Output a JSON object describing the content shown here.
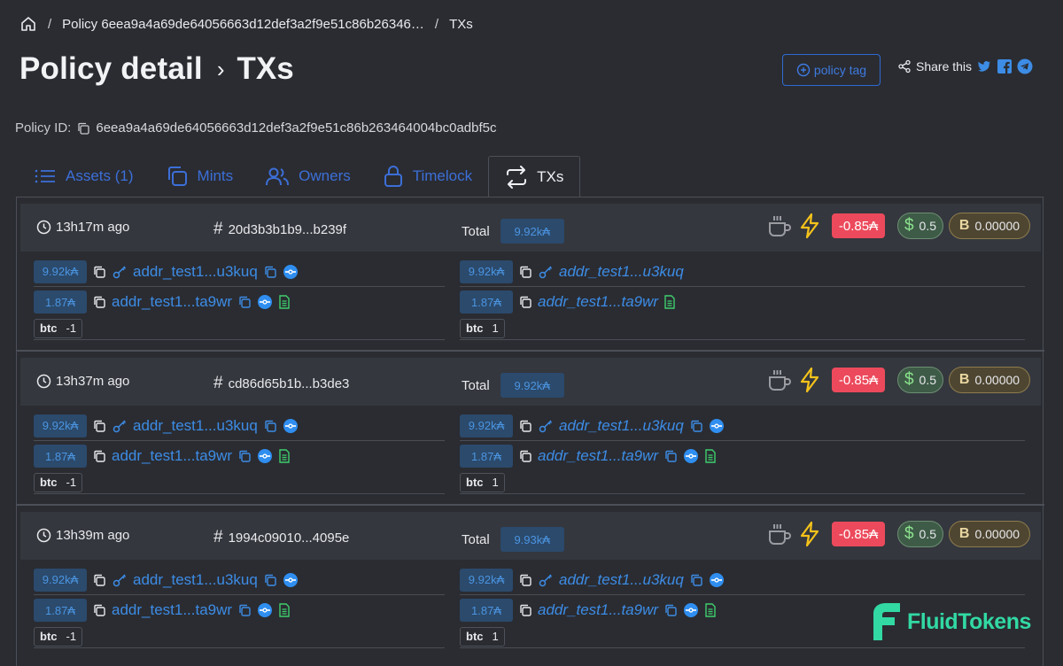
{
  "breadcrumb": {
    "home_icon": "home-icon",
    "policy_crumb": "Policy 6eea9a4a69de64056663d12def3a2f9e51c86b26346…",
    "current": "TXs"
  },
  "header": {
    "title": "Policy detail",
    "subtitle": "TXs",
    "policy_tag_label": "policy tag",
    "share_label": "Share this"
  },
  "policy": {
    "label": "Policy ID:",
    "id": "6eea9a4a69de64056663d12def3a2f9e51c86b263464004bc0adbf5c"
  },
  "tabs": [
    {
      "label": "Assets (1)",
      "icon": "list-icon",
      "active": false
    },
    {
      "label": "Mints",
      "icon": "copy-icon",
      "active": false
    },
    {
      "label": "Owners",
      "icon": "users-icon",
      "active": false
    },
    {
      "label": "Timelock",
      "icon": "lock-icon",
      "active": false
    },
    {
      "label": "TXs",
      "icon": "swap-icon",
      "active": true
    }
  ],
  "colors": {
    "background": "#2a2c32",
    "accent": "#3d8ce5",
    "fee": "#ec4a5c",
    "logo": "#32d9a3"
  },
  "transactions": [
    {
      "time": "13h17m ago",
      "hash": "20d3b3b1b9...b239f",
      "total_label": "Total",
      "total": "9.92k₳",
      "fee": "-0.85₳",
      "ada_value": "0.5",
      "btc_value": "0.00000",
      "inputs": [
        {
          "amount": "9.92k₳",
          "address": "addr_test1...u3kuq"
        },
        {
          "amount": "1.87₳",
          "address": "addr_test1...ta9wr"
        }
      ],
      "input_token": {
        "name": "btc",
        "qty": "-1"
      },
      "outputs": [
        {
          "amount": "9.92k₳",
          "address": "addr_test1...u3kuq"
        },
        {
          "amount": "1.87₳",
          "address": "addr_test1...ta9wr"
        }
      ],
      "output_token": {
        "name": "btc",
        "qty": "1"
      }
    },
    {
      "time": "13h37m ago",
      "hash": "cd86d65b1b...b3de3",
      "total_label": "Total",
      "total": "9.92k₳",
      "fee": "-0.85₳",
      "ada_value": "0.5",
      "btc_value": "0.00000",
      "inputs": [
        {
          "amount": "9.92k₳",
          "address": "addr_test1...u3kuq"
        },
        {
          "amount": "1.87₳",
          "address": "addr_test1...ta9wr"
        }
      ],
      "input_token": {
        "name": "btc",
        "qty": "-1"
      },
      "outputs": [
        {
          "amount": "9.92k₳",
          "address": "addr_test1...u3kuq"
        },
        {
          "amount": "1.87₳",
          "address": "addr_test1...ta9wr"
        }
      ],
      "output_token": {
        "name": "btc",
        "qty": "1"
      }
    },
    {
      "time": "13h39m ago",
      "hash": "1994c09010...4095e",
      "total_label": "Total",
      "total": "9.93k₳",
      "fee": "-0.85₳",
      "ada_value": "0.5",
      "btc_value": "0.00000",
      "inputs": [
        {
          "amount": "9.92k₳",
          "address": "addr_test1...u3kuq"
        },
        {
          "amount": "1.87₳",
          "address": "addr_test1...ta9wr"
        }
      ],
      "input_token": {
        "name": "btc",
        "qty": "-1"
      },
      "outputs": [
        {
          "amount": "9.92k₳",
          "address": "addr_test1...u3kuq"
        },
        {
          "amount": "1.87₳",
          "address": "addr_test1...ta9wr"
        }
      ],
      "output_token": {
        "name": "btc",
        "qty": "1"
      }
    }
  ],
  "logo": {
    "text": "FluidTokens"
  }
}
